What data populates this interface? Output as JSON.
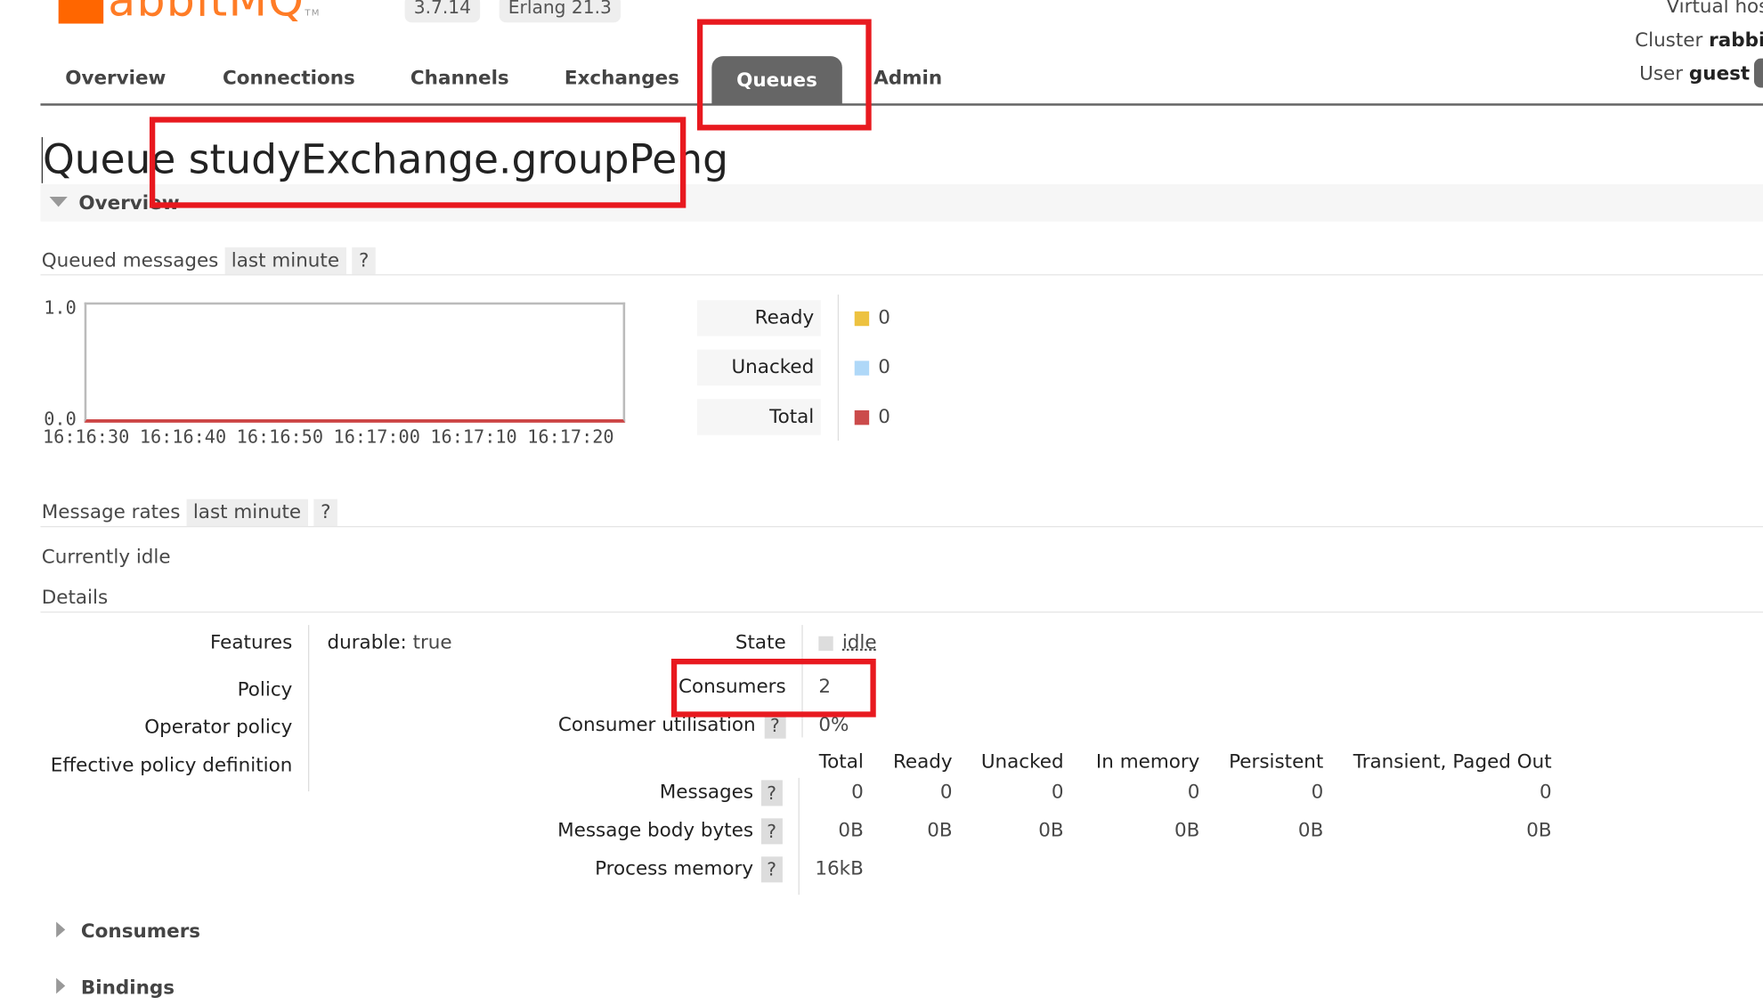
{
  "header": {
    "logo": "RabbitMQ",
    "version": "3.7.14",
    "erlang": "Erlang 21.3",
    "right": {
      "vhost_label": "Virtual host",
      "cluster_label": "Cluster",
      "cluster_value": "rabbi",
      "user_label": "User",
      "user_value": "guest"
    }
  },
  "nav": {
    "tabs": [
      {
        "label": "Overview"
      },
      {
        "label": "Connections"
      },
      {
        "label": "Channels"
      },
      {
        "label": "Exchanges"
      },
      {
        "label": "Queues",
        "active": true
      },
      {
        "label": "Admin"
      }
    ]
  },
  "page": {
    "title_prefix": "Queue",
    "queue_name": "studyExchange.groupPeng"
  },
  "overview": {
    "label": "Overview",
    "queued": {
      "label": "Queued messages",
      "range": "last minute",
      "help": "?"
    },
    "chart_data": {
      "type": "line",
      "ylim": [
        0.0,
        1.0
      ],
      "yticks": [
        "1.0",
        "0.0"
      ],
      "xticks": [
        "16:16:30",
        "16:16:40",
        "16:16:50",
        "16:17:00",
        "16:17:10",
        "16:17:20"
      ],
      "series": [
        {
          "name": "Ready",
          "color": "#edc240",
          "values": [
            0,
            0,
            0,
            0,
            0,
            0
          ]
        },
        {
          "name": "Unacked",
          "color": "#afd8f8",
          "values": [
            0,
            0,
            0,
            0,
            0,
            0
          ]
        },
        {
          "name": "Total",
          "color": "#cb4b4b",
          "values": [
            0,
            0,
            0,
            0,
            0,
            0
          ]
        }
      ]
    },
    "legend": [
      {
        "label": "Ready",
        "value": "0",
        "color": "#edc240"
      },
      {
        "label": "Unacked",
        "value": "0",
        "color": "#afd8f8"
      },
      {
        "label": "Total",
        "value": "0",
        "color": "#cb4b4b"
      }
    ],
    "rates": {
      "label": "Message rates",
      "range": "last minute",
      "help": "?",
      "status": "Currently idle"
    },
    "details": {
      "label": "Details",
      "features_label": "Features",
      "features_key": "durable:",
      "features_value": "true",
      "policy_label": "Policy",
      "operator_policy_label": "Operator policy",
      "effective_policy_label": "Effective policy definition",
      "state_label": "State",
      "state_value": "idle",
      "consumers_label": "Consumers",
      "consumers_value": "2",
      "utilisation_label": "Consumer utilisation",
      "utilisation_value": "0%",
      "columns": [
        "Total",
        "Ready",
        "Unacked",
        "In memory",
        "Persistent",
        "Transient, Paged Out"
      ],
      "rows": [
        {
          "label": "Messages",
          "values": [
            "0",
            "0",
            "0",
            "0",
            "0",
            "0"
          ]
        },
        {
          "label": "Message body bytes",
          "values": [
            "0B",
            "0B",
            "0B",
            "0B",
            "0B",
            "0B"
          ]
        },
        {
          "label": "Process memory",
          "values": [
            "16kB"
          ]
        }
      ]
    }
  },
  "sections": {
    "consumers": "Consumers",
    "bindings": "Bindings"
  },
  "colors": {
    "annotation": "#e8191f",
    "active_tab": "#666666"
  }
}
